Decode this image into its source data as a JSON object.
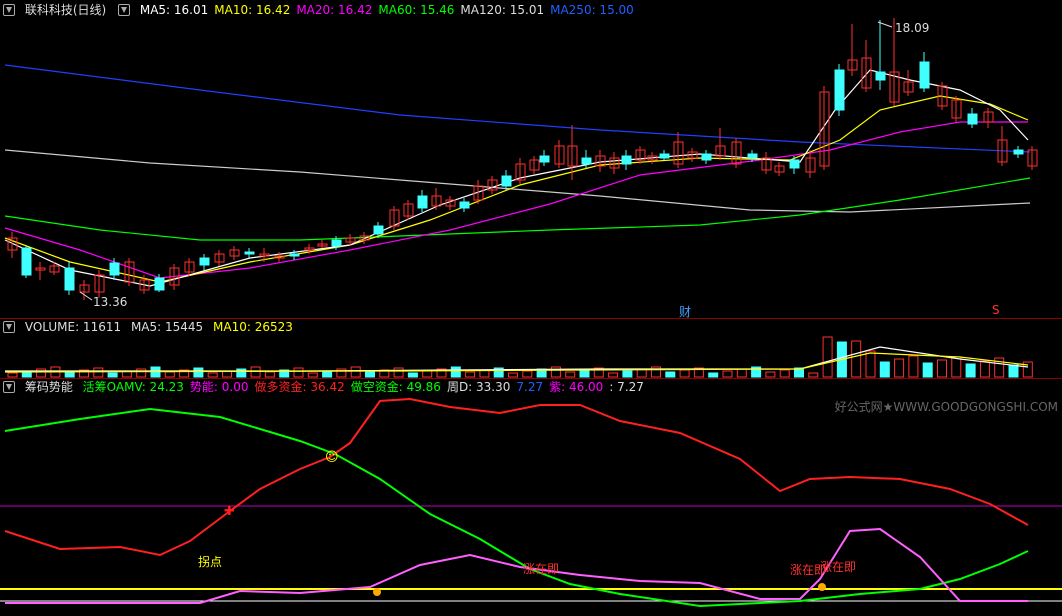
{
  "main_panel": {
    "title": "联科科技(日线)",
    "ma": [
      {
        "label": "MA5: 16.01",
        "color": "#ffffff"
      },
      {
        "label": "MA10: 16.42",
        "color": "#ffff00"
      },
      {
        "label": "MA20: 16.42",
        "color": "#ff00ff"
      },
      {
        "label": "MA60: 15.46",
        "color": "#00ff00"
      },
      {
        "label": "MA120: 15.01",
        "color": "#dddddd"
      },
      {
        "label": "MA250: 15.00",
        "color": "#2060ff"
      }
    ],
    "high_label": "18.09",
    "low_label": "13.36",
    "marker_cai": "财",
    "marker_s": "S"
  },
  "volume_panel": {
    "title": "VOLUME: 11611",
    "ma5": "MA5: 15445",
    "ma10": "MA10: 26523"
  },
  "indicator_panel": {
    "title": "筹码势能",
    "items": [
      {
        "label": "活筹OAMV: 24.23",
        "color": "#00ff00"
      },
      {
        "label": "势能: 0.00",
        "color": "#ff00ff"
      },
      {
        "label": "做多资金: 36.42",
        "color": "#ff2020"
      },
      {
        "label": "做空资金: 49.86",
        "color": "#00ff00"
      },
      {
        "label": "周D: 33.30",
        "color": "#dddddd"
      },
      {
        "label": "7.27",
        "color": "#2060ff"
      },
      {
        "label": "紫: 46.00",
        "color": "#ff00ff"
      },
      {
        "label": ": 7.27",
        "color": "#dddddd"
      }
    ],
    "label_guaidian": "拐点",
    "label_zhangzaiji_1": "涨在即",
    "label_zhangzaiji_2": "涨在即",
    "label_zhangzaiji_3": "涨在即"
  },
  "watermark": "好公式网★WWW.GOODGONGSHI.COM",
  "colors": {
    "up": "#ff3030",
    "down": "#40ffff",
    "flat": "#ffffff",
    "border": "#8b0000"
  }
}
